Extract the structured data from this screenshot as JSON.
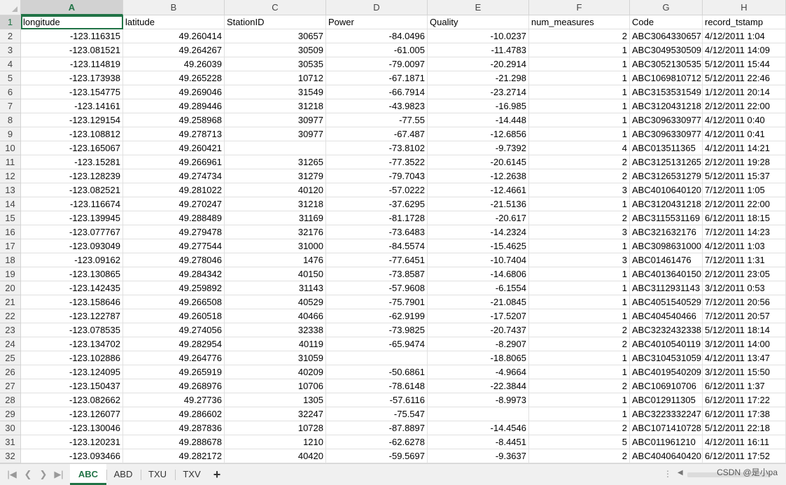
{
  "columns": [
    {
      "letter": "A",
      "name": "longitude",
      "type": "num"
    },
    {
      "letter": "B",
      "name": "latitude",
      "type": "num"
    },
    {
      "letter": "C",
      "name": "StationID",
      "type": "num"
    },
    {
      "letter": "D",
      "name": "Power",
      "type": "num"
    },
    {
      "letter": "E",
      "name": "Quality",
      "type": "num"
    },
    {
      "letter": "F",
      "name": "num_measures",
      "type": "num"
    },
    {
      "letter": "G",
      "name": "Code",
      "type": "txt"
    },
    {
      "letter": "H",
      "name": "record_tstamp",
      "type": "txt"
    }
  ],
  "rows": [
    [
      "-123.116315",
      "49.260414",
      "30657",
      "-84.0496",
      "-10.0237",
      "2",
      "ABC3064330657",
      "4/12/2011 1:04"
    ],
    [
      "-123.081521",
      "49.264267",
      "30509",
      "-61.005",
      "-11.4783",
      "1",
      "ABC3049530509",
      "4/12/2011 14:09"
    ],
    [
      "-123.114819",
      "49.26039",
      "30535",
      "-79.0097",
      "-20.2914",
      "1",
      "ABC3052130535",
      "5/12/2011 15:44"
    ],
    [
      "-123.173938",
      "49.265228",
      "10712",
      "-67.1871",
      "-21.298",
      "1",
      "ABC1069810712",
      "5/12/2011 22:46"
    ],
    [
      "-123.154775",
      "49.269046",
      "31549",
      "-66.7914",
      "-23.2714",
      "1",
      "ABC3153531549",
      "1/12/2011 20:14"
    ],
    [
      "-123.14161",
      "49.289446",
      "31218",
      "-43.9823",
      "-16.985",
      "1",
      "ABC3120431218",
      "2/12/2011 22:00"
    ],
    [
      "-123.129154",
      "49.258968",
      "30977",
      "-77.55",
      "-14.448",
      "1",
      "ABC3096330977",
      "4/12/2011 0:40"
    ],
    [
      "-123.108812",
      "49.278713",
      "30977",
      "-67.487",
      "-12.6856",
      "1",
      "ABC3096330977",
      "4/12/2011 0:41"
    ],
    [
      "-123.165067",
      "49.260421",
      "",
      "-73.8102",
      "-9.7392",
      "4",
      "ABC013511365",
      "4/12/2011 14:21"
    ],
    [
      "-123.15281",
      "49.266961",
      "31265",
      "-77.3522",
      "-20.6145",
      "2",
      "ABC3125131265",
      "2/12/2011 19:28"
    ],
    [
      "-123.128239",
      "49.274734",
      "31279",
      "-79.7043",
      "-12.2638",
      "2",
      "ABC3126531279",
      "5/12/2011 15:37"
    ],
    [
      "-123.082521",
      "49.281022",
      "40120",
      "-57.0222",
      "-12.4661",
      "3",
      "ABC4010640120",
      "7/12/2011 1:05"
    ],
    [
      "-123.116674",
      "49.270247",
      "31218",
      "-37.6295",
      "-21.5136",
      "1",
      "ABC3120431218",
      "2/12/2011 22:00"
    ],
    [
      "-123.139945",
      "49.288489",
      "31169",
      "-81.1728",
      "-20.617",
      "2",
      "ABC3115531169",
      "6/12/2011 18:15"
    ],
    [
      "-123.077767",
      "49.279478",
      "32176",
      "-73.6483",
      "-14.2324",
      "3",
      "ABC321632176",
      "7/12/2011 14:23"
    ],
    [
      "-123.093049",
      "49.277544",
      "31000",
      "-84.5574",
      "-15.4625",
      "1",
      "ABC3098631000",
      "4/12/2011 1:03"
    ],
    [
      "-123.09162",
      "49.278046",
      "1476",
      "-77.6451",
      "-10.7404",
      "3",
      "ABC01461476",
      "7/12/2011 1:31"
    ],
    [
      "-123.130865",
      "49.284342",
      "40150",
      "-73.8587",
      "-14.6806",
      "1",
      "ABC4013640150",
      "2/12/2011 23:05"
    ],
    [
      "-123.142435",
      "49.259892",
      "31143",
      "-57.9608",
      "-6.1554",
      "1",
      "ABC3112931143",
      "3/12/2011 0:53"
    ],
    [
      "-123.158646",
      "49.266508",
      "40529",
      "-75.7901",
      "-21.0845",
      "1",
      "ABC4051540529",
      "7/12/2011 20:56"
    ],
    [
      "-123.122787",
      "49.260518",
      "40466",
      "-62.9199",
      "-17.5207",
      "1",
      "ABC404540466",
      "7/12/2011 20:57"
    ],
    [
      "-123.078535",
      "49.274056",
      "32338",
      "-73.9825",
      "-20.7437",
      "2",
      "ABC3232432338",
      "5/12/2011 18:14"
    ],
    [
      "-123.134702",
      "49.282954",
      "40119",
      "-65.9474",
      "-8.2907",
      "2",
      "ABC4010540119",
      "3/12/2011 14:00"
    ],
    [
      "-123.102886",
      "49.264776",
      "31059",
      "",
      "-18.8065",
      "1",
      "ABC3104531059",
      "4/12/2011 13:47"
    ],
    [
      "-123.124095",
      "49.265919",
      "40209",
      "-50.6861",
      "-4.9664",
      "1",
      "ABC4019540209",
      "3/12/2011 15:50"
    ],
    [
      "-123.150437",
      "49.268976",
      "10706",
      "-78.6148",
      "-22.3844",
      "2",
      "ABC106910706",
      "6/12/2011 1:37"
    ],
    [
      "-123.082662",
      "49.27736",
      "1305",
      "-57.6116",
      "-8.9973",
      "1",
      "ABC012911305",
      "6/12/2011 17:22"
    ],
    [
      "-123.126077",
      "49.286602",
      "32247",
      "-75.547",
      "",
      "1",
      "ABC3223332247",
      "6/12/2011 17:38"
    ],
    [
      "-123.130046",
      "49.287836",
      "10728",
      "-87.8897",
      "-14.4546",
      "2",
      "ABC1071410728",
      "5/12/2011 22:18"
    ],
    [
      "-123.120231",
      "49.288678",
      "1210",
      "-62.6278",
      "-8.4451",
      "5",
      "ABC011961210",
      "4/12/2011 16:11"
    ],
    [
      "-123.093466",
      "49.282172",
      "40420",
      "-59.5697",
      "-9.3637",
      "2",
      "ABC4040640420",
      "6/12/2011 17:52"
    ]
  ],
  "sheet_tabs": [
    {
      "label": "ABC",
      "active": true
    },
    {
      "label": "ABD",
      "active": false
    },
    {
      "label": "TXU",
      "active": false
    },
    {
      "label": "TXV",
      "active": false
    }
  ],
  "add_sheet_label": "+",
  "scroll_dots": "⋮",
  "watermark": "CSDN @是小pa",
  "colors": {
    "accent": "#217346",
    "header_bg": "#f0f0f0",
    "grid": "#e1e1e1"
  }
}
